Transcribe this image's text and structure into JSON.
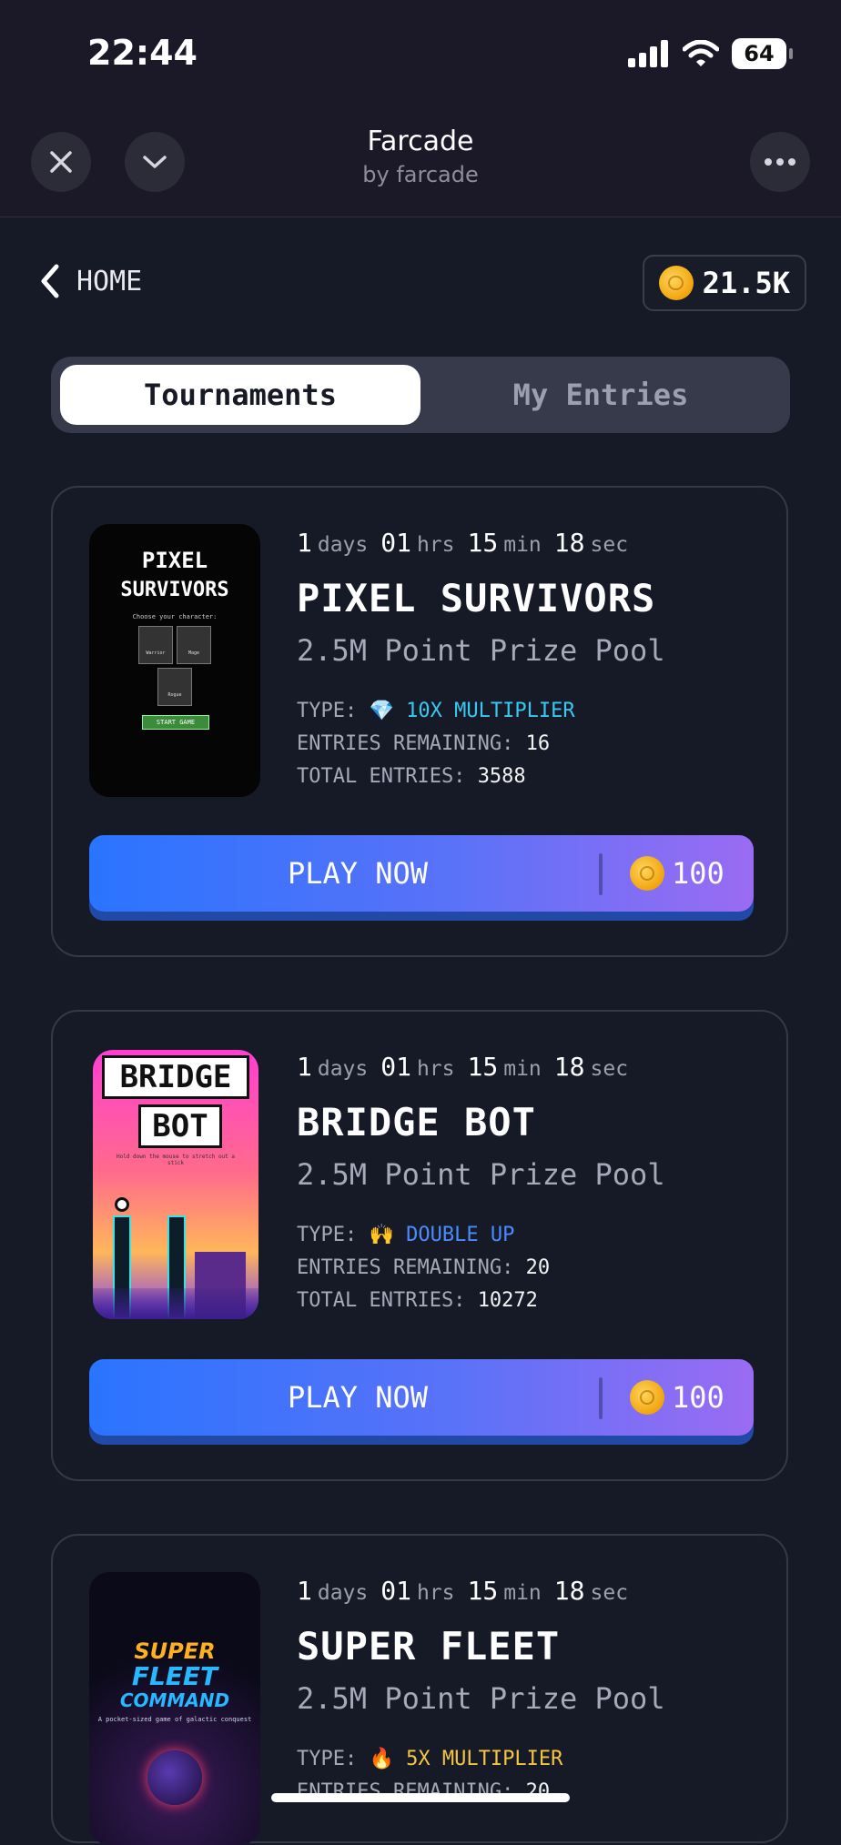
{
  "status_bar": {
    "time": "22:44",
    "battery": "64"
  },
  "nav": {
    "title": "Farcade",
    "subtitle": "by farcade",
    "close_icon": "close-icon",
    "collapse_icon": "chevron-down-icon",
    "more_icon": "more-horizontal-icon"
  },
  "header": {
    "back_label": "HOME",
    "balance": "21.5K"
  },
  "tabs": [
    {
      "label": "Tournaments",
      "active": true
    },
    {
      "label": "My Entries",
      "active": false
    }
  ],
  "countdown_units": {
    "days": "days",
    "hrs": "hrs",
    "min": "min",
    "sec": "sec"
  },
  "labels": {
    "type": "TYPE:",
    "entries_remaining": "ENTRIES REMAINING:",
    "total_entries": "TOTAL ENTRIES:",
    "play": "PLAY NOW"
  },
  "tournaments": [
    {
      "days": "1",
      "hrs": "01",
      "min": "15",
      "sec": "18",
      "title": "PIXEL SURVIVORS",
      "prize": "2.5M Point Prize Pool",
      "type_icon": "💎",
      "type_label": "10X MULTIPLIER",
      "type_color": "#38c9f2",
      "entries_remaining": "16",
      "total_entries": "3588",
      "cost": "100",
      "thumb": {
        "title1": "PIXEL",
        "title2": "SURVIVORS",
        "subtitle": "Choose your character:",
        "btn": "START GAME",
        "c1": "Warrior",
        "c2": "Mage",
        "c3": "Rogue"
      }
    },
    {
      "days": "1",
      "hrs": "01",
      "min": "15",
      "sec": "18",
      "title": "BRIDGE BOT",
      "prize": "2.5M Point Prize Pool",
      "type_icon": "🙌",
      "type_label": "DOUBLE UP",
      "type_color": "#4a8cff",
      "entries_remaining": "20",
      "total_entries": "10272",
      "cost": "100",
      "thumb": {
        "title1": "BRIDGE",
        "title2": "BOT",
        "subtitle": "Hold down the mouse to stretch out a stick"
      }
    },
    {
      "days": "1",
      "hrs": "01",
      "min": "15",
      "sec": "18",
      "title": "SUPER FLEET",
      "prize": "2.5M Point Prize Pool",
      "type_icon": "🔥",
      "type_label": "5X MULTIPLIER",
      "type_color": "#f5c542",
      "entries_remaining": "20",
      "thumb": {
        "title1": "SUPER",
        "title2": "FLEET",
        "title3": "COMMAND",
        "subtitle": "A pocket-sized game of galactic conquest"
      }
    }
  ]
}
